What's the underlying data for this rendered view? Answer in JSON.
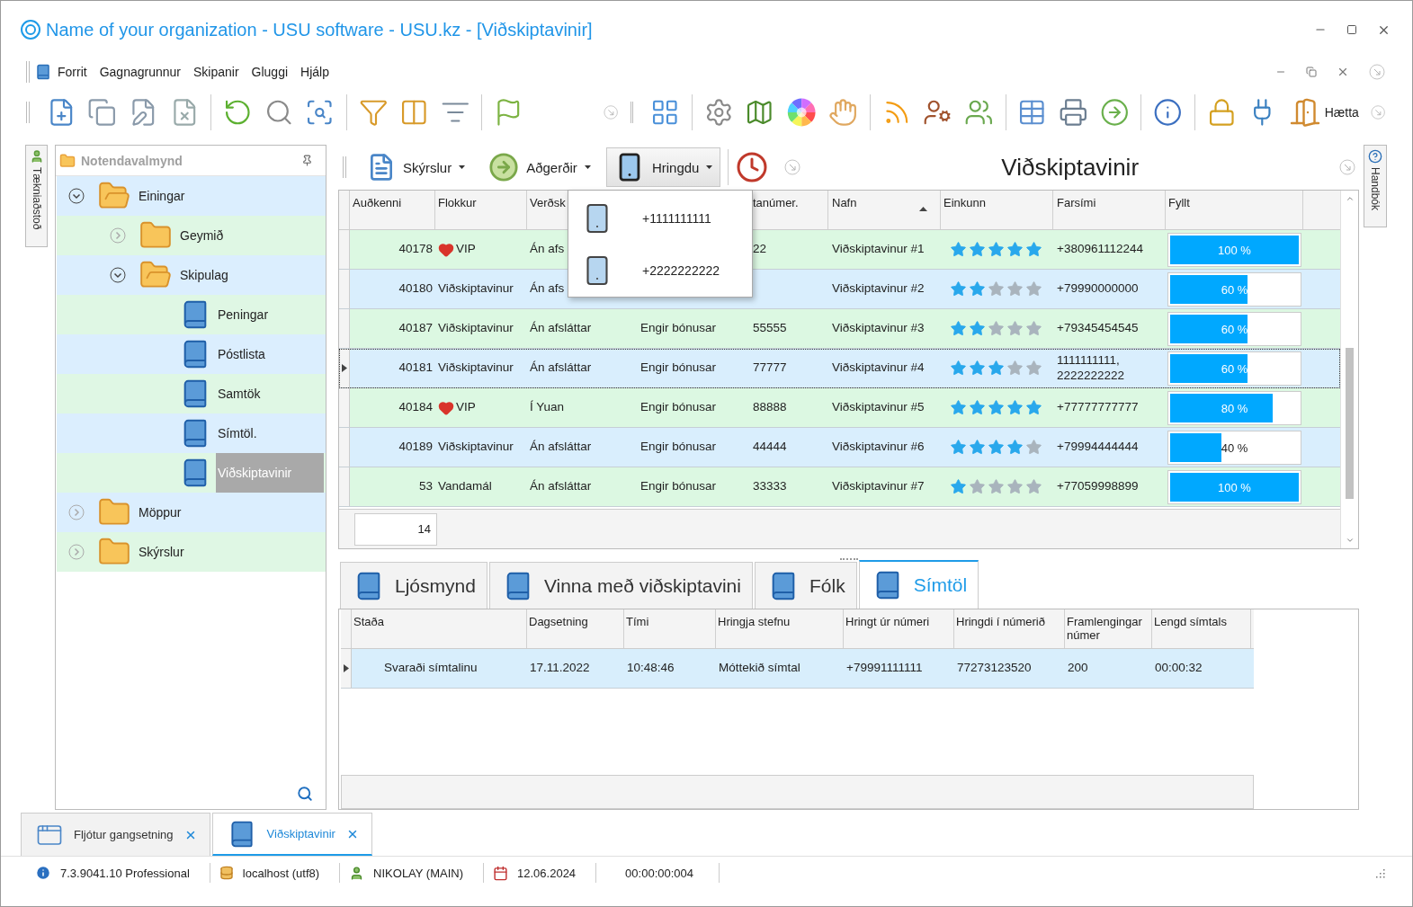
{
  "window": {
    "title": "Name of your organization - USU software - USU.kz - [Viðskiptavinir]"
  },
  "menu": [
    "Forrit",
    "Gagnagrunnur",
    "Skipanir",
    "Gluggi",
    "Hjálp"
  ],
  "toolbar": {
    "exit_label": "Hætta"
  },
  "side_tabs": {
    "left": "Tækniaðstoð",
    "right": "Handbók"
  },
  "navigation": {
    "title": "Notendavalmynd",
    "items": [
      {
        "label": "Einingar",
        "kind": "folder",
        "expanded": true,
        "selected": false,
        "children": [
          {
            "label": "Geymið",
            "kind": "folder",
            "expanded": false,
            "selected": false
          },
          {
            "label": "Skipulag",
            "kind": "folder",
            "expanded": true,
            "selected": false,
            "children": [
              {
                "label": "Peningar",
                "kind": "module",
                "selected": false
              },
              {
                "label": "Póstlista",
                "kind": "module",
                "selected": false
              },
              {
                "label": "Samtök",
                "kind": "module",
                "selected": false
              },
              {
                "label": "Símtöl.",
                "kind": "module",
                "selected": false
              },
              {
                "label": "Viðskiptavinir",
                "kind": "module",
                "selected": true
              }
            ]
          }
        ]
      },
      {
        "label": "Möppur",
        "kind": "folder",
        "expanded": false,
        "selected": false
      },
      {
        "label": "Skýrslur",
        "kind": "folder",
        "expanded": false,
        "selected": false
      }
    ]
  },
  "actions": [
    {
      "label": "Skýrslur",
      "pressed": false
    },
    {
      "label": "Aðgerðir",
      "pressed": false
    },
    {
      "label": "Hringdu",
      "pressed": true
    }
  ],
  "page_title": "Viðskiptavinir",
  "call_menu": [
    "+1111111111",
    "+2222222222"
  ],
  "table": {
    "columns": [
      {
        "label": "Auðkenni",
        "sorted": false
      },
      {
        "label": "Flokkur",
        "sorted": false
      },
      {
        "label": "Verðsk",
        "sorted": false
      },
      {
        "label": "tanúmer.",
        "sorted": false
      },
      {
        "label": "Nafn",
        "sorted": true
      },
      {
        "label": "Einkunn",
        "sorted": false
      },
      {
        "label": "Farsími",
        "sorted": false
      },
      {
        "label": "Fyllt",
        "sorted": false
      }
    ],
    "rows": [
      {
        "id": "40178",
        "vip": true,
        "category": "VIP",
        "price_list": "Án afs",
        "number": "22",
        "name": "Viðskiptavinur #1",
        "stars": 5,
        "phone": "+380961112244",
        "level": 1,
        "fill": "100 %",
        "selected": false
      },
      {
        "id": "40180",
        "vip": false,
        "category": "Viðskiptavinur",
        "price_list": "Án afs",
        "name": "Viðskiptavinur #2",
        "stars": 2,
        "phone": "+79990000000",
        "level": 0.6,
        "fill": "60 %",
        "selected": false
      },
      {
        "id": "40187",
        "vip": false,
        "category": "Viðskiptavinur",
        "price_list": "Án afsláttar",
        "bonus": "Engir bónusar",
        "number": "55555",
        "name": "Viðskiptavinur #3",
        "stars": 2,
        "phone": "+79345454545",
        "level": 0.6,
        "fill": "60 %",
        "selected": false
      },
      {
        "id": "40181",
        "vip": false,
        "category": "Viðskiptavinur",
        "price_list": "Án afsláttar",
        "bonus": "Engir bónusar",
        "number": "77777",
        "name": "Viðskiptavinur #4",
        "stars": 3,
        "phone": "1111111111, 2222222222",
        "level": 0.6,
        "fill": "60 %",
        "selected": true
      },
      {
        "id": "40184",
        "vip": true,
        "category": "VIP",
        "price_list": "Í Yuan",
        "bonus": "Engir bónusar",
        "number": "88888",
        "name": "Viðskiptavinur #5",
        "stars": 5,
        "phone": "+77777777777",
        "level": 0.8,
        "fill": "80 %",
        "selected": false
      },
      {
        "id": "40189",
        "vip": false,
        "category": "Viðskiptavinur",
        "price_list": "Án afsláttar",
        "bonus": "Engir bónusar",
        "number": "44444",
        "name": "Viðskiptavinur #6",
        "stars": 4,
        "phone": "+79994444444",
        "level": 0.4,
        "fill": "40 %",
        "selected": false
      },
      {
        "id": "53",
        "vip": false,
        "category": "Vandamál",
        "price_list": "Án afsláttar",
        "bonus": "Engir bónusar",
        "number": "33333",
        "name": "Viðskiptavinur #7",
        "stars": 1,
        "phone": "+77059998899",
        "level": 1,
        "fill": "100 %",
        "selected": false
      }
    ],
    "count": "14"
  },
  "details": {
    "tabs": [
      {
        "label": "Ljósmynd",
        "selected": false
      },
      {
        "label": "Vinna með viðskiptavini",
        "selected": false
      },
      {
        "label": "Fólk",
        "selected": false
      },
      {
        "label": "Símtöl",
        "selected": true
      }
    ],
    "columns": [
      "Staða",
      "Dagsetning",
      "Tími",
      "Hringja stefnu",
      "Hringt úr númeri",
      "Hringdi í númerið",
      "Framlengingar númer",
      "Lengd símtals"
    ],
    "rows": [
      {
        "cells": [
          "Svaraði símtalinu",
          "17.11.2022",
          "10:48:46",
          "Móttekið símtal",
          "+79991111111",
          "77273123520",
          "200",
          "00:00:32"
        ],
        "selected": true
      }
    ]
  },
  "doc_tabs": [
    {
      "label": "Fljótur gangsetning",
      "selected": false
    },
    {
      "label": "Viðskiptavinir",
      "selected": true
    }
  ],
  "status_bar": {
    "version": "7.3.9041.10 Professional",
    "server": "localhost (utf8)",
    "user": "NIKOLAY (MAIN)",
    "date": "12.06.2024",
    "timer": "00:00:00:004"
  }
}
